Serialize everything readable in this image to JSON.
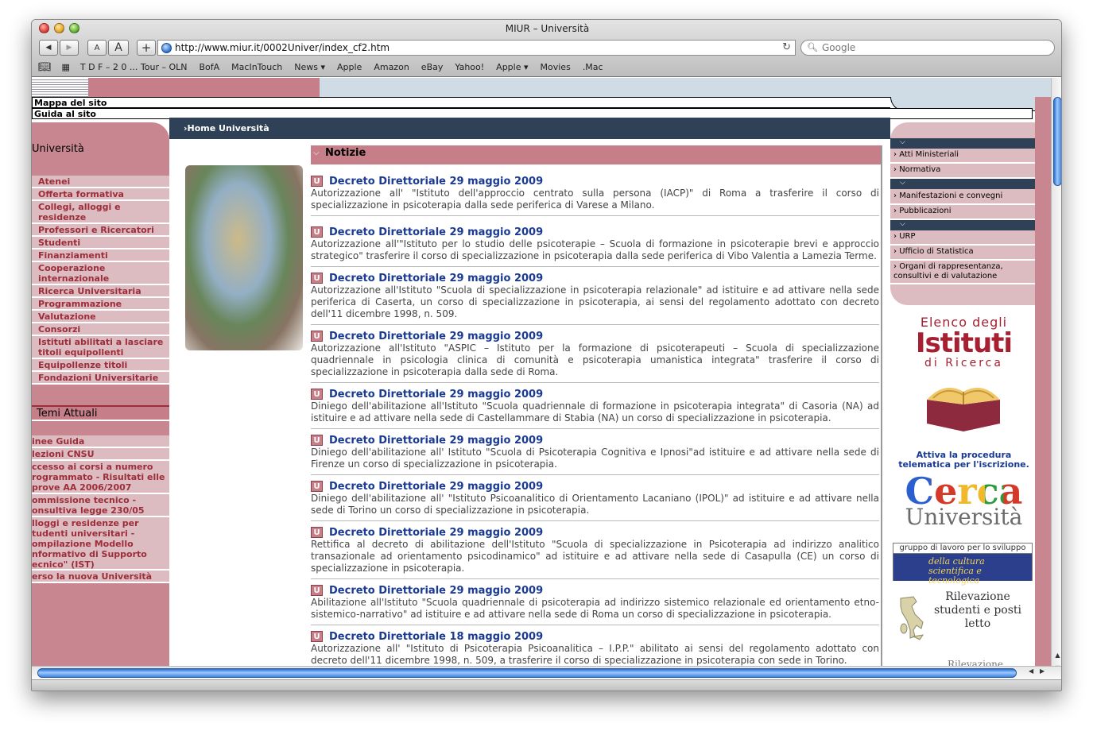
{
  "window": {
    "title": "MIUR – Università"
  },
  "toolbar": {
    "back": "◀",
    "forward": "▶",
    "text_small": "A",
    "text_large": "A",
    "add": "+",
    "reload": "↻"
  },
  "address": {
    "url": "http://www.miur.it/0002Univer/index_cf2.htm"
  },
  "search": {
    "placeholder": "Google"
  },
  "bookmarks": [
    "T D F – 2 0 ... Tour – OLN",
    "BofA",
    "MacInTouch",
    "News ▾",
    "Apple",
    "Amazon",
    "eBay",
    "Yahoo!",
    "Apple ▾",
    "Movies",
    ".Mac"
  ],
  "site": {
    "links": [
      "Mappa del sito",
      "Guida al sito"
    ],
    "breadcrumb": "Home Università"
  },
  "left": {
    "section1": "Università",
    "items1": [
      "Atenei",
      "Offerta formativa",
      "Collegi, alloggi e residenze",
      "Professori e Ricercatori",
      "Studenti",
      "Finanziamenti",
      "Cooperazione internazionale",
      "Ricerca Universitaria",
      "Programmazione",
      "Valutazione",
      "Consorzi",
      "Istituti abilitati a lasciare titoli equipollenti",
      "Equipollenze titoli",
      "Fondazioni Universitarie"
    ],
    "section2": "Temi Attuali",
    "items2": [
      "inee Guida",
      "lezioni CNSU",
      "ccesso ai corsi a numero rogrammato - Risultati elle prove AA 2006/2007",
      "ommissione tecnico - onsultiva legge 230/05",
      "lloggi e residenze per tudenti universitari - ompilazione Modello nformativo di Supporto ecnico\" (IST)",
      "erso la nuova Università"
    ]
  },
  "right": {
    "group1": [
      "Atti Ministeriali",
      "Normativa"
    ],
    "group2": [
      "Manifestazioni e convegni",
      "Pubblicazioni"
    ],
    "group3": [
      "URP",
      "Ufficio di Statistica",
      "Organi di rappresentanza, consultivi e di valutazione"
    ],
    "promo_elenco": {
      "line1": "Elenco degli",
      "line2": "Istituti",
      "line3": "di Ricerca"
    },
    "activate": "Attiva la procedura telematica per l'iscrizione.",
    "cerca": {
      "line1": "Cerca",
      "line2": "Università"
    },
    "gruppo": {
      "top": "gruppo di lavoro per lo sviluppo",
      "bottom": "della cultura scientifica e tecnologica"
    },
    "rilevazione": "Rilevazione studenti e posti letto",
    "rilevazione2": "Rilevazione"
  },
  "news": {
    "heading": "Notizie",
    "badge": "U",
    "items": [
      {
        "title": "Decreto Direttoriale 29 maggio 2009",
        "body": "Autorizzazione all' \"Istituto dell'approccio centrato sulla persona (IACP)\" di Roma a trasferire il corso di specializzazione in psicoterapia dalla sede periferica di Varese a Milano."
      },
      {
        "title": "Decreto Direttoriale 29 maggio 2009",
        "body": "Autorizzazione all'\"Istituto per lo studio delle psicoterapie – Scuola di formazione in psicoterapie brevi e approccio strategico\" trasferire il corso di specializzazione in psicoterapia dalla sede periferica di Vibo Valentia a Lamezia Terme."
      },
      {
        "title": "Decreto Direttoriale 29 maggio 2009",
        "body": "Autorizzazione all'Istituto \"Scuola di specializzazione in psicoterapia relazionale\" ad istituire e ad attivare nella sede periferica di Caserta, un corso di specializzazione in psicoterapia, ai sensi del regolamento adottato con decreto dell'11 dicembre 1998, n. 509."
      },
      {
        "title": "Decreto Direttoriale 29 maggio 2009",
        "body": "Autorizzazione all'Istituto \"ASPIC – Istituto per la formazione di psicoterapeuti – Scuola di specializzazione quadriennale in psicologia clinica di comunità e psicoterapia umanistica integrata\"  trasferire  il corso di specializzazione in psicoterapia dalla sede di Roma."
      },
      {
        "title": "Decreto Direttoriale 29 maggio 2009",
        "body": "Diniego dell'abilitazione all'Istituto \"Scuola quadriennale di formazione in psicoterapia integrata\" di Casoria (NA) ad istituire e ad attivare nella sede di Castellammare di Stabia (NA) un corso di specializzazione in psicoterapia."
      },
      {
        "title": "Decreto Direttoriale 29 maggio 2009",
        "body": "Diniego dell'abilitazione all' Istituto \"Scuola di Psicoterapia Cognitiva e Ipnosi\"ad istituire e ad attivare nella sede di Firenze un corso di specializzazione in psicoterapia."
      },
      {
        "title": "Decreto Direttoriale 29 maggio 2009",
        "body": "Diniego dell'abilitazione all' \"Istituto Psicoanalitico di Orientamento Lacaniano (IPOL)\" ad istituire e ad attivare nella sede di Torino un corso di specializzazione in psicoterapia."
      },
      {
        "title": "Decreto Direttoriale 29 maggio 2009",
        "body": "Rettifica al decreto di abilitazione dell'Istituto \"Scuola di specializzazione in Psicoterapia ad indirizzo analitico transazionale ad orientamento psicodinamico\" ad istituire e ad attivare nella sede di Casapulla (CE) un corso di specializzazione in psicoterapia."
      },
      {
        "title": "Decreto Direttoriale 29 maggio 2009",
        "body": "Abilitazione all'Istituto \"Scuola quadriennale di psicoterapia ad indirizzo sistemico relazionale ed orientamento etno-sistemico-narrativo\" ad istituire e ad attivare nella sede di Roma un corso di specializzazione in psicoterapia."
      },
      {
        "title": "Decreto Direttoriale 18 maggio 2009",
        "body": "Autorizzazione all' \"Istituto di Psicoterapia Psicoanalitica – I.P.P.\" abilitato ai sensi del regolamento adottato con decreto dell'11 dicembre 1998, n. 509, a trasferire il corso di specializzazione in psicoterapia con sede in Torino."
      }
    ]
  },
  "colors": {
    "pink": "#c67f88",
    "pink_light": "#dcbcc0",
    "navy": "#2e4156",
    "link": "#1a3a93",
    "brand_red": "#a62032"
  }
}
